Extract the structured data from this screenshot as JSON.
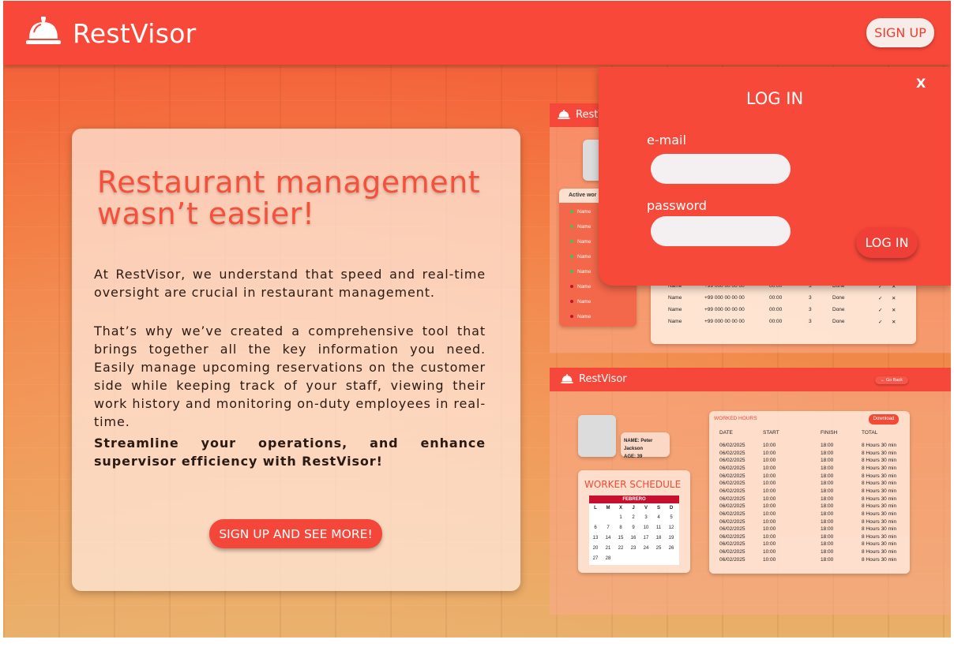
{
  "header": {
    "brand": "RestVisor",
    "signup": "SIGN UP",
    "logo_icon": "service-bell-icon"
  },
  "hero": {
    "title": "Restaurant management wasn’t easier!",
    "p1": "At RestVisor, we understand that speed and real-time oversight are crucial in restaurant management.",
    "p2": "That’s why we’ve created a comprehensive tool that brings together all the key information you need. Easily manage upcoming reservations on the customer side while keeping track of your staff, viewing their work history and monitoring on-duty employees in real-time.",
    "p3": "Streamline your operations, and enhance supervisor efficiency with RestVisor!",
    "cta": "SIGN UP AND SEE MORE!"
  },
  "login": {
    "close": "X",
    "title": "LOG IN",
    "email_label": "e-mail",
    "password_label": "password",
    "button": "LOG IN",
    "email_value": "",
    "password_value": ""
  },
  "preview1": {
    "brand": "RestVisor",
    "active_workers_title": "Active wor",
    "workers": [
      {
        "name": "Name",
        "status": "green"
      },
      {
        "name": "Name",
        "status": "green"
      },
      {
        "name": "Name",
        "status": "green"
      },
      {
        "name": "Name",
        "status": "green"
      },
      {
        "name": "Name",
        "status": "green"
      },
      {
        "name": "Name",
        "status": "red"
      },
      {
        "name": "Name",
        "status": "red"
      },
      {
        "name": "Name",
        "status": "red"
      }
    ],
    "rows": [
      {
        "name": "Name",
        "phone": "+99 000 00 00 00",
        "time": "00:00",
        "count": "3",
        "status": "Done"
      },
      {
        "name": "Name",
        "phone": "+99 000 00 00 00",
        "time": "00:00",
        "count": "3",
        "status": "Done"
      },
      {
        "name": "Name",
        "phone": "+99 000 00 00 00",
        "time": "00:00",
        "count": "3",
        "status": "Done"
      },
      {
        "name": "Name",
        "phone": "+99 000 00 00 00",
        "time": "00:00",
        "count": "3",
        "status": "Done"
      }
    ]
  },
  "preview2": {
    "brand": "RestVisor",
    "go_back": "← Go Back",
    "name_line": "NAME: Peter Jackson",
    "age_line": "AGE: 39",
    "schedule_title": "WORKER SCHEDULE",
    "calendar": {
      "month": "FEBRERO",
      "days": [
        "L",
        "M",
        "X",
        "J",
        "V",
        "S",
        "D"
      ],
      "weeks": [
        [
          "",
          "",
          "1",
          "2",
          "3",
          "4",
          "5"
        ],
        [
          "6",
          "7",
          "8",
          "9",
          "10",
          "11",
          "12"
        ],
        [
          "13",
          "14",
          "15",
          "16",
          "17",
          "18",
          "19"
        ],
        [
          "20",
          "21",
          "22",
          "23",
          "24",
          "25",
          "26"
        ],
        [
          "27",
          "28",
          "",
          "",
          "",
          "",
          ""
        ]
      ]
    },
    "hours_title": "WORKED HOURS",
    "download": "Download",
    "columns": [
      "DATE",
      "START",
      "FINISH",
      "TOTAL"
    ],
    "rows": [
      [
        "06/02/2025",
        "10:00",
        "18:00",
        "8 Hours 30 min"
      ],
      [
        "06/02/2025",
        "10:00",
        "18:00",
        "8 Hours 30 min"
      ],
      [
        "06/02/2025",
        "10:00",
        "18:00",
        "8 Hours 30 min"
      ],
      [
        "06/02/2025",
        "10:00",
        "18:00",
        "8 Hours 30 min"
      ],
      [
        "06/02/2025",
        "10:00",
        "18:00",
        "8 Hours 30 min"
      ],
      [
        "06/02/2025",
        "10:00",
        "18:00",
        "8 Hours 30 min"
      ],
      [
        "06/02/2025",
        "10:00",
        "18:00",
        "8 Hours 30 min"
      ],
      [
        "06/02/2025",
        "10:00",
        "18:00",
        "8 Hours 30 min"
      ],
      [
        "06/02/2025",
        "10:00",
        "18:00",
        "8 Hours 30 min"
      ],
      [
        "06/02/2025",
        "10:00",
        "18:00",
        "8 Hours 30 min"
      ],
      [
        "06/02/2025",
        "10:00",
        "18:00",
        "8 Hours 30 min"
      ],
      [
        "06/02/2025",
        "10:00",
        "18:00",
        "8 Hours 30 min"
      ],
      [
        "06/02/2025",
        "10:00",
        "18:00",
        "8 Hours 30 min"
      ],
      [
        "06/02/2025",
        "10:00",
        "18:00",
        "8 Hours 30 min"
      ],
      [
        "06/02/2025",
        "10:00",
        "18:00",
        "8 Hours 30 min"
      ],
      [
        "06/02/2025",
        "10:00",
        "18:00",
        "8 Hours 30 min"
      ]
    ]
  },
  "colors": {
    "primary": "#f7483a",
    "accent": "#f4513d"
  }
}
